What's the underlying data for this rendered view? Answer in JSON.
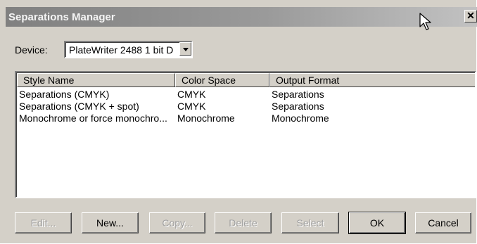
{
  "window": {
    "title": "Separations Manager",
    "close_glyph": "✕"
  },
  "device": {
    "label": "Device:",
    "value": "PlateWriter 2488 1 bit D"
  },
  "list": {
    "columns": [
      "Style Name",
      "Color Space",
      "Output Format"
    ],
    "rows": [
      [
        "Separations (CMYK)",
        "CMYK",
        "Separations"
      ],
      [
        "Separations (CMYK + spot)",
        "CMYK",
        "Separations"
      ],
      [
        "Monochrome or force monochro...",
        "Monochrome",
        "Monochrome"
      ]
    ]
  },
  "buttons": {
    "edit": "Edit...",
    "new": "New...",
    "copy": "Copy...",
    "delete": "Delete",
    "select": "Select",
    "ok": "OK",
    "cancel": "Cancel"
  },
  "colors": {
    "face": "#d4d0c8",
    "title_gradient_start": "#808080",
    "disabled_text": "#a0a0a0"
  }
}
